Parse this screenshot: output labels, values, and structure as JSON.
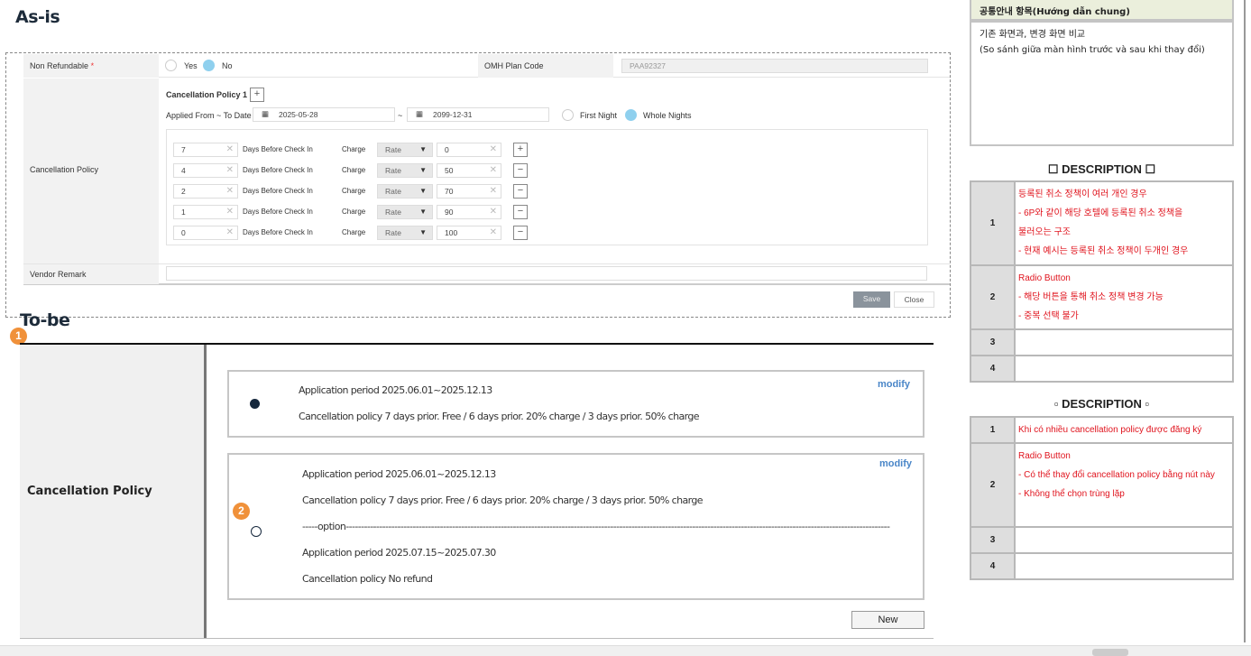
{
  "asis": {
    "title": "As-is",
    "non_refundable_label": "Non Refundable",
    "required_mark": "*",
    "yes_label": "Yes",
    "no_label": "No",
    "omh_label": "OMH Plan Code",
    "omh_value": "PAA92327",
    "cancel_label": "Cancellation Policy",
    "policy_title": "Cancellation Policy 1",
    "add_icon": "+",
    "applied_label": "Applied From ~ To Date",
    "from_date": "2025-05-28",
    "tilde": "~",
    "to_date": "2099-12-31",
    "first_night": "First Night",
    "whole_nights": "Whole Nights",
    "rows": [
      {
        "days": "7",
        "days_label": "Days Before Check In",
        "charge": "Charge",
        "type": "Rate",
        "value": "0",
        "action": "+"
      },
      {
        "days": "4",
        "days_label": "Days Before Check In",
        "charge": "Charge",
        "type": "Rate",
        "value": "50",
        "action": "−"
      },
      {
        "days": "2",
        "days_label": "Days Before Check In",
        "charge": "Charge",
        "type": "Rate",
        "value": "70",
        "action": "−"
      },
      {
        "days": "1",
        "days_label": "Days Before Check In",
        "charge": "Charge",
        "type": "Rate",
        "value": "90",
        "action": "−"
      },
      {
        "days": "0",
        "days_label": "Days Before Check In",
        "charge": "Charge",
        "type": "Rate",
        "value": "100",
        "action": "−"
      }
    ],
    "vendor_remark_label": "Vendor Remark",
    "vendor_remark_value": "",
    "save": "Save",
    "close": "Close"
  },
  "tobe": {
    "title": "To-be",
    "badge1": "1",
    "badge2": "2",
    "label": "Cancellation Policy",
    "option1": {
      "period": "Application period 2025.06.01~2025.12.13",
      "policy": "Cancellation policy 7 days prior. Free  / 6 days prior. 20% charge  /  3 days prior. 50% charge",
      "modify": "modify",
      "selected": true
    },
    "option2": {
      "period": "Application period 2025.06.01~2025.12.13",
      "policy": "Cancellation policy 7 days prior. Free  / 6 days prior. 20% charge  /  3 days prior. 50% charge",
      "separator": "-----option-----------------------------------------------------------------------------------------------------------------------------------------------------------------------------------",
      "period2": "Application period 2025.07.15~2025.07.30",
      "policy2": "Cancellation policy No refund",
      "modify": "modify",
      "selected": false
    },
    "new": "New"
  },
  "guide": {
    "header": "공통안내 항목(Hướng dẫn chung)",
    "line1": "기존 화면과, 변경 화면 비교",
    "line2": "(So sánh giữa màn hình trước và sau khi thay đổi)"
  },
  "desc_ko": {
    "title": "☐ DESCRIPTION ☐",
    "rows": [
      {
        "n": "1",
        "lines": [
          "등록된 취소 정책이 여러 개인 경우",
          "- 6P와 같이 해당 호텔에 등록된 취소 정책을",
          "불러오는 구조",
          "- 현재 예시는 등록된 취소 정책이 두개인 경우"
        ]
      },
      {
        "n": "2",
        "lines": [
          "Radio Button",
          "- 해당 버튼을 통해 취소 정책 변경 가능",
          "- 중복 선택 불가"
        ]
      },
      {
        "n": "3",
        "lines": []
      },
      {
        "n": "4",
        "lines": []
      }
    ]
  },
  "desc_vi": {
    "title": "▫ DESCRIPTION ▫",
    "rows": [
      {
        "n": "1",
        "lines": [
          "Khi có nhiều cancellation policy được đăng ký"
        ]
      },
      {
        "n": "2",
        "lines": [
          "Radio Button",
          "- Có thể thay đổi cancellation policy bằng nút này",
          "- Không thể chọn trùng lặp"
        ]
      },
      {
        "n": "3",
        "lines": []
      },
      {
        "n": "4",
        "lines": []
      }
    ]
  }
}
